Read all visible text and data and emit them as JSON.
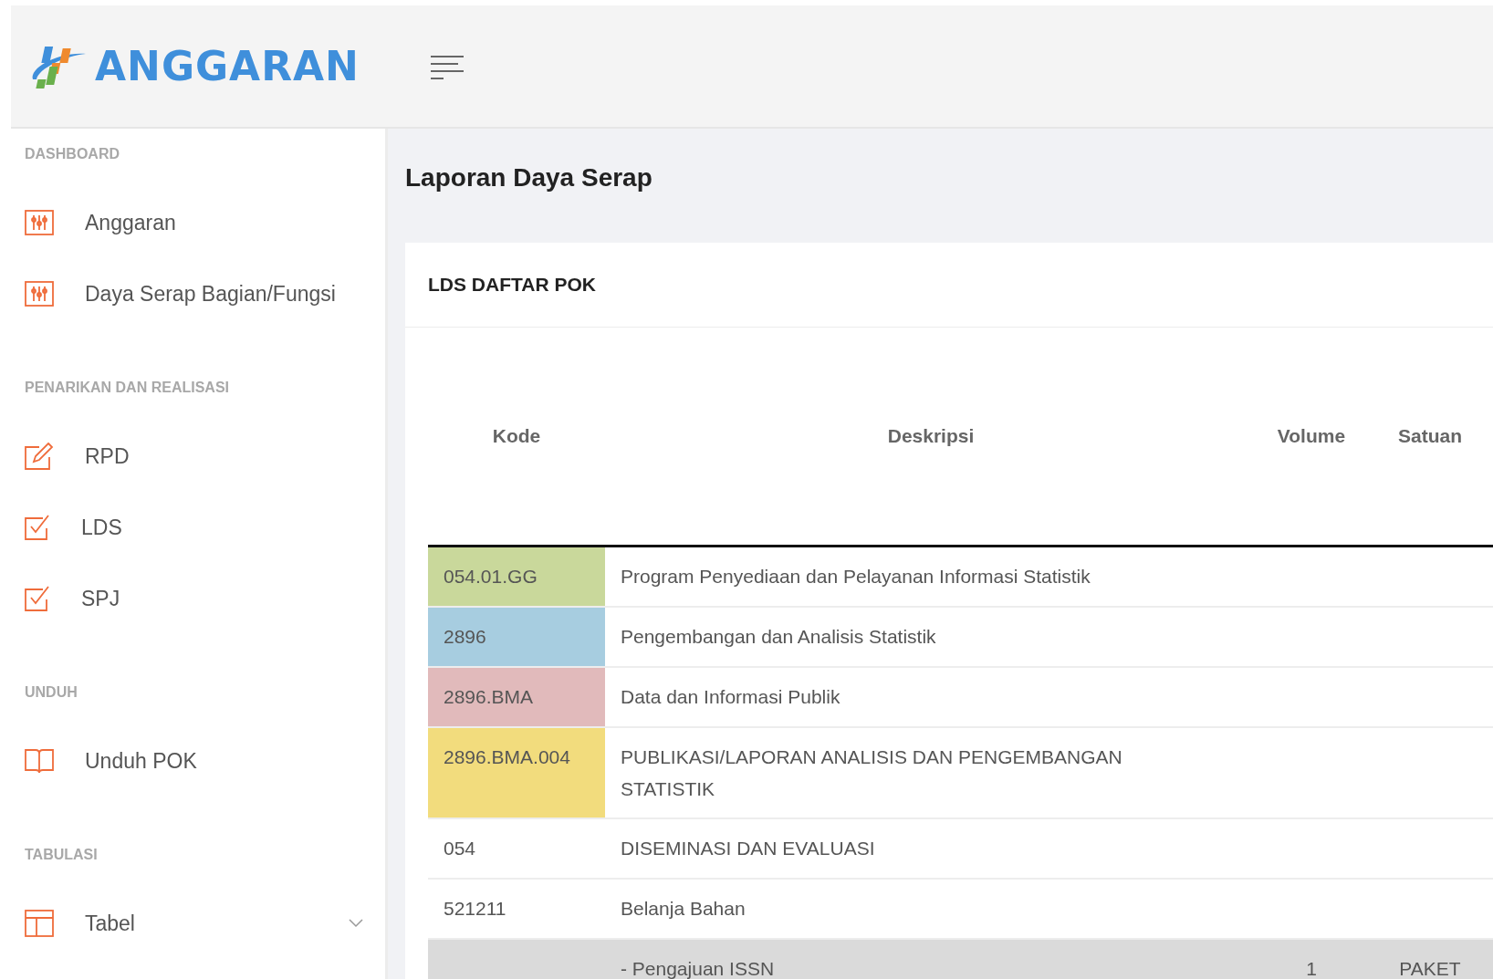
{
  "header": {
    "logo_text": "ANGGARAN"
  },
  "sidebar": {
    "sections": [
      {
        "heading": "DASHBOARD",
        "items": [
          {
            "label": "Anggaran",
            "kind": "sliders"
          },
          {
            "label": "Daya Serap Bagian/Fungsi",
            "kind": "sliders"
          }
        ]
      },
      {
        "heading": "PENARIKAN DAN REALISASI",
        "items": [
          {
            "label": "RPD",
            "kind": "edit"
          },
          {
            "label": "LDS",
            "kind": "check"
          },
          {
            "label": "SPJ",
            "kind": "check"
          }
        ]
      },
      {
        "heading": "UNDUH",
        "items": [
          {
            "label": "Unduh POK",
            "kind": "book"
          }
        ]
      },
      {
        "heading": "TABULASI",
        "items": [
          {
            "label": "Tabel",
            "kind": "table",
            "expanded": false
          }
        ]
      }
    ]
  },
  "page_title": "Laporan Daya Serap",
  "card": {
    "title": "LDS DAFTAR POK",
    "table": {
      "columns": [
        "Kode",
        "Deskripsi",
        "Volume",
        "Satuan"
      ],
      "rows": [
        {
          "cells": [
            "054.01.GG",
            "Program Penyediaan dan Pelayanan Informasi Statistik",
            "",
            ""
          ],
          "color": "#c9d89b",
          "highlighted": false
        },
        {
          "cells": [
            "2896",
            "Pengembangan dan Analisis Statistik",
            "",
            ""
          ],
          "color": "#a7cde0",
          "highlighted": false
        },
        {
          "cells": [
            "2896.BMA",
            "Data dan Informasi Publik",
            "",
            ""
          ],
          "color": "#e1babb",
          "highlighted": false
        },
        {
          "cells": [
            "2896.BMA.004",
            "PUBLIKASI/LAPORAN ANALISIS DAN PENGEMBANGAN STATISTIK",
            "",
            ""
          ],
          "color": "#f2dc7d",
          "highlighted": false
        },
        {
          "cells": [
            "054",
            "DISEMINASI DAN EVALUASI",
            "",
            ""
          ],
          "highlighted": false
        },
        {
          "cells": [
            "521211",
            "Belanja Bahan",
            "",
            ""
          ],
          "highlighted": false
        },
        {
          "cells": [
            "",
            "- Pengajuan ISSN",
            "1",
            "PAKET"
          ],
          "highlighted": true
        }
      ]
    }
  }
}
